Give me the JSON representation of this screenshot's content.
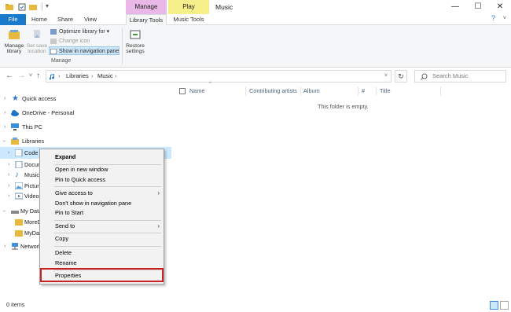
{
  "titlebar": {
    "title": "Music",
    "context_tabs": [
      {
        "label": "Manage",
        "color": "#e9b8e6"
      },
      {
        "label": "Play",
        "color": "#f6f08a"
      }
    ],
    "minimize": "—",
    "maximize": "☐",
    "close": "✕"
  },
  "ribbon_tabs": [
    "File",
    "Home",
    "Share",
    "View",
    "Library Tools",
    "Music Tools"
  ],
  "ribbon": {
    "manage_library": "Manage library",
    "set_save_location": "Set save location",
    "optimize_library": "Optimize library for",
    "change_icon": "Change icon",
    "show_in_nav": "Show in navigation pane",
    "restore_settings": "Restore settings",
    "group_label": "Manage"
  },
  "address": {
    "crumbs": [
      "Libraries",
      "Music"
    ],
    "search_placeholder": "Search Music",
    "back_icon": "back-arrow-icon",
    "forward_icon": "forward-arrow-icon",
    "recent_icon": "chevron-down-icon",
    "up_icon": "up-arrow-icon"
  },
  "nav": {
    "items": [
      {
        "label": "Quick access",
        "icon": "star-icon"
      },
      {
        "label": "OneDrive - Personal",
        "icon": "cloud-icon"
      },
      {
        "label": "This PC",
        "icon": "computer-icon"
      },
      {
        "label": "Libraries",
        "icon": "library-icon"
      },
      {
        "label": "Code",
        "icon": "code-library-icon"
      },
      {
        "label": "Docum",
        "icon": "documents-icon"
      },
      {
        "label": "Music",
        "icon": "music-icon"
      },
      {
        "label": "Picture",
        "icon": "pictures-icon"
      },
      {
        "label": "Videos",
        "icon": "videos-icon"
      },
      {
        "label": "My Data",
        "icon": "drive-icon"
      },
      {
        "label": "MoreD",
        "icon": "folder-icon"
      },
      {
        "label": "MyDat",
        "icon": "folder-icon"
      },
      {
        "label": "Network",
        "icon": "network-icon"
      }
    ]
  },
  "content": {
    "columns": [
      "Name",
      "Contributing artists",
      "Album",
      "#",
      "Title"
    ],
    "empty_message": "This folder is empty."
  },
  "status": {
    "item_count": "0 items"
  },
  "context_menu": {
    "items": [
      {
        "label": "Expand",
        "bold": true
      },
      {
        "label": "Open in new window"
      },
      {
        "label": "Pin to Quick access"
      },
      {
        "label": "Give access to",
        "submenu": true
      },
      {
        "label": "Don't show in navigation pane"
      },
      {
        "label": "Pin to Start"
      },
      {
        "label": "Send to",
        "submenu": true
      },
      {
        "label": "Copy"
      },
      {
        "label": "Delete"
      },
      {
        "label": "Rename"
      },
      {
        "label": "Properties",
        "highlighted": true
      }
    ]
  }
}
